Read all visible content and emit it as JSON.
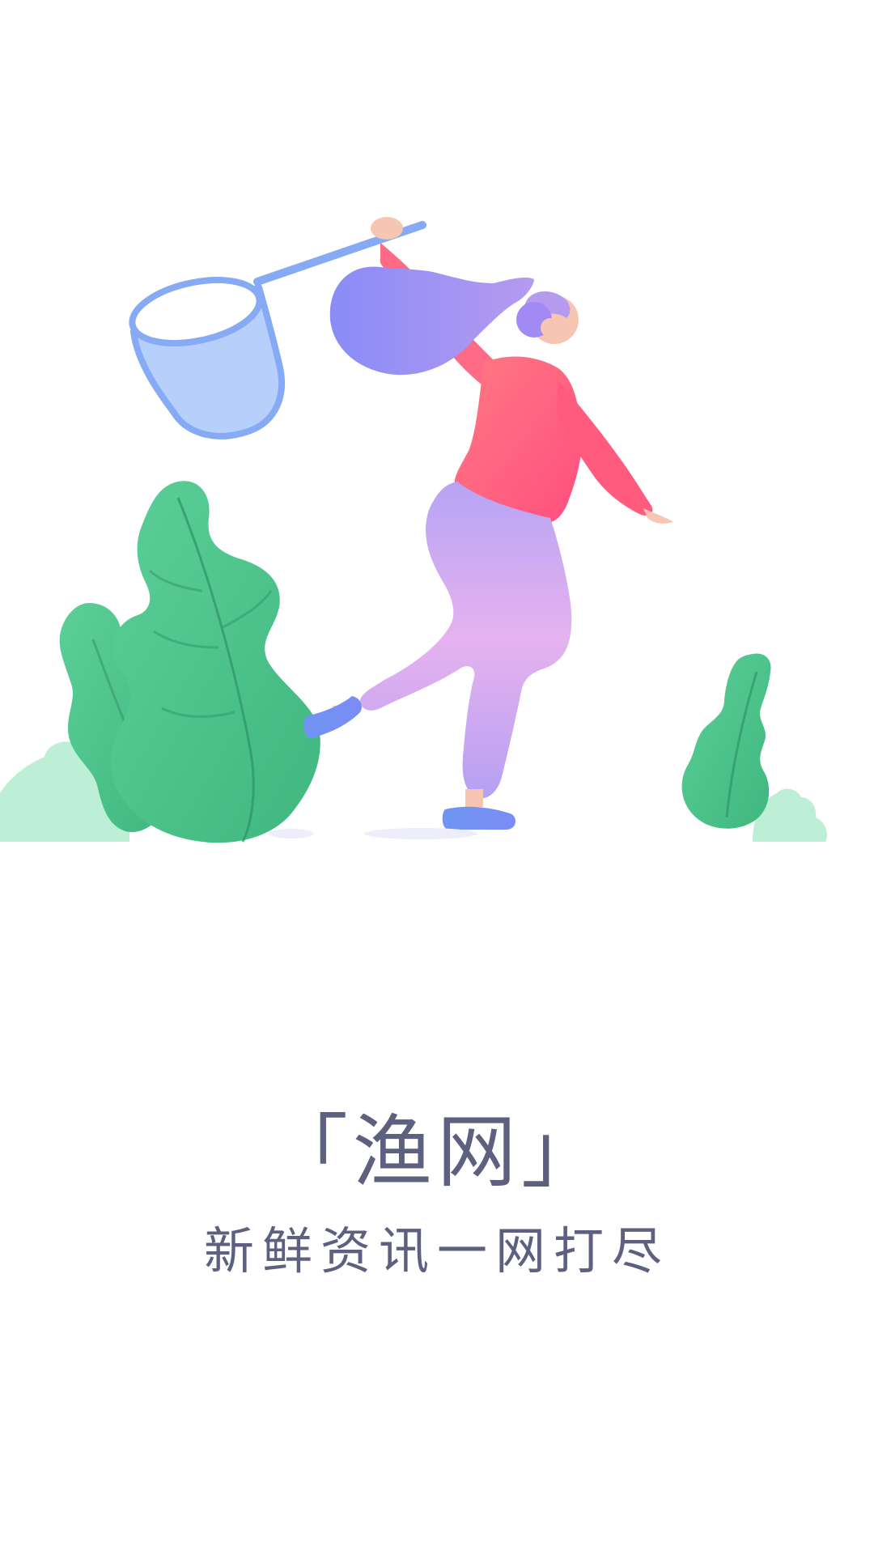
{
  "splash": {
    "title": "「渔网」",
    "slogan": "新鲜资讯一网打尽"
  },
  "illustration": {
    "subject": "woman-catching-with-net",
    "colors": {
      "leaf_dark": "#3fb77f",
      "leaf_light": "#5ccf98",
      "bush": "#bdeed6",
      "hair": "#8a8cf7",
      "sweater": "#ff5b7f",
      "pants": "#b9a4f2",
      "net_frame": "#86aaf3",
      "net_mesh": "#b7cffb",
      "shoe": "#6f94f2",
      "skin": "#f6c6b3"
    }
  },
  "theme": {
    "background": "#ffffff",
    "text": "#5e6080"
  }
}
